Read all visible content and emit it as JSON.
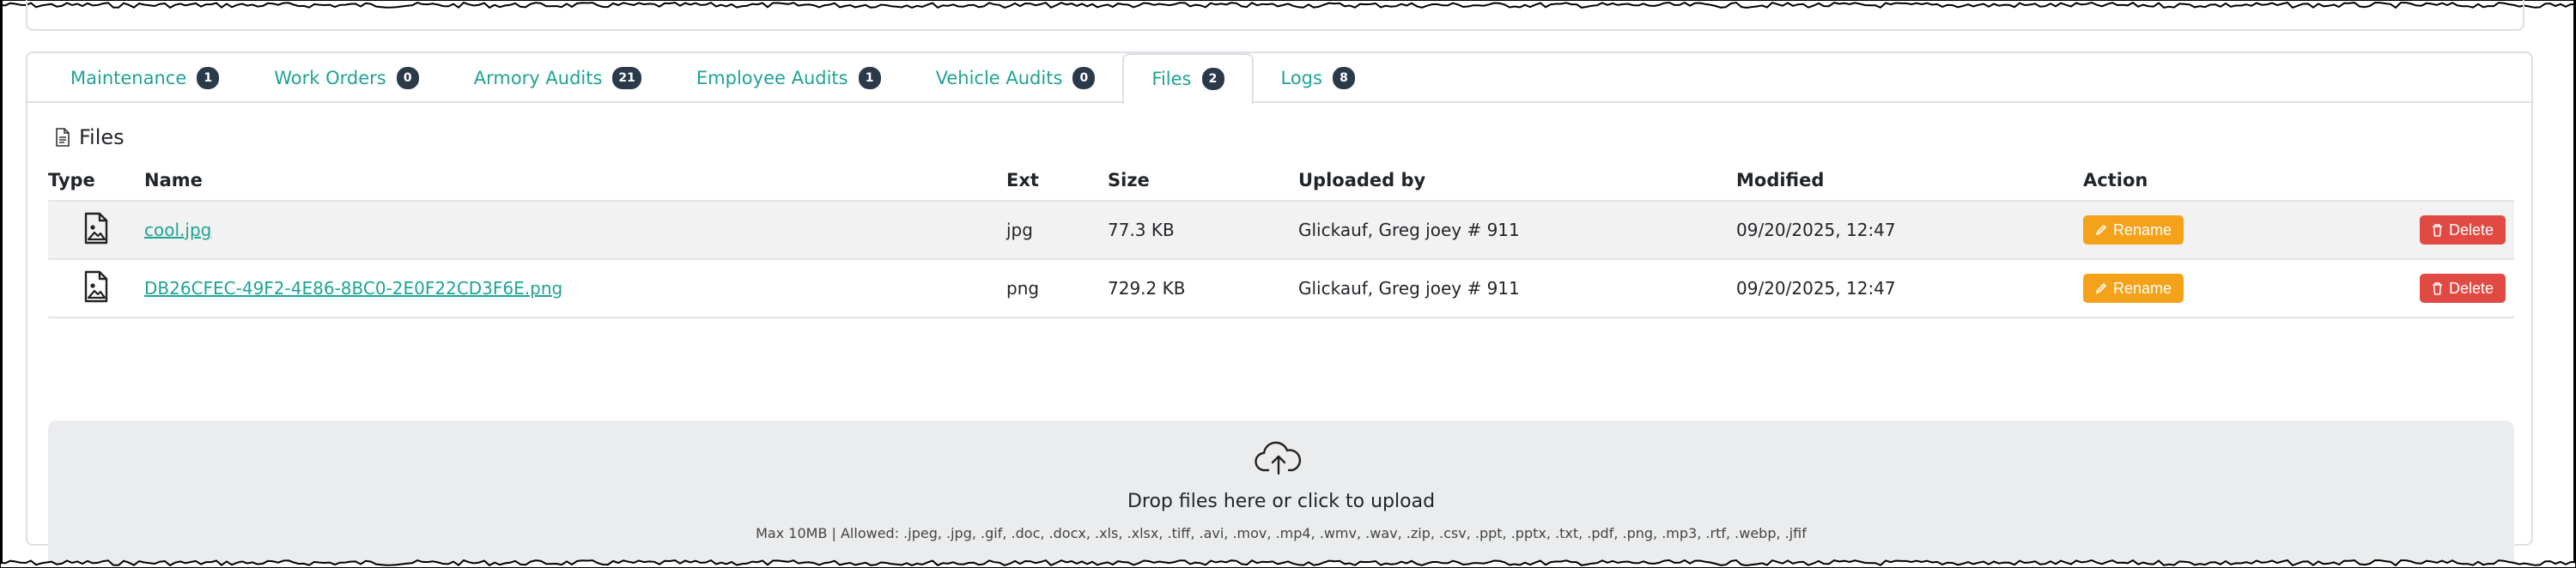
{
  "tabs": [
    {
      "label": "Maintenance",
      "count": "1"
    },
    {
      "label": "Work Orders",
      "count": "0"
    },
    {
      "label": "Armory Audits",
      "count": "21"
    },
    {
      "label": "Employee Audits",
      "count": "1"
    },
    {
      "label": "Vehicle Audits",
      "count": "0"
    },
    {
      "label": "Files",
      "count": "2"
    },
    {
      "label": "Logs",
      "count": "8"
    }
  ],
  "active_tab": "Files",
  "section": {
    "title": "Files",
    "icon": "file-icon"
  },
  "table": {
    "headers": {
      "type": "Type",
      "name": "Name",
      "ext": "Ext",
      "size": "Size",
      "uploaded_by": "Uploaded by",
      "modified": "Modified",
      "action": "Action"
    },
    "rows": [
      {
        "type_icon": "image-file-icon",
        "name": "cool.jpg",
        "ext": "jpg",
        "size": "77.3 KB",
        "uploaded_by": "Glickauf, Greg joey # 911",
        "modified": "09/20/2025, 12:47",
        "rename_label": "Rename",
        "delete_label": "Delete"
      },
      {
        "type_icon": "image-file-icon",
        "name": "DB26CFEC-49F2-4E86-8BC0-2E0F22CD3F6E.png",
        "ext": "png",
        "size": "729.2 KB",
        "uploaded_by": "Glickauf, Greg joey # 911",
        "modified": "09/20/2025, 12:47",
        "rename_label": "Rename",
        "delete_label": "Delete"
      }
    ]
  },
  "dropzone": {
    "icon": "cloud-upload-icon",
    "text": "Drop files here or click to upload",
    "hint": "Max 10MB | Allowed: .jpeg, .jpg, .gif, .doc, .docx, .xls, .xlsx, .tiff, .avi, .mov, .mp4, .wmv, .wav, .zip, .csv, .ppt, .pptx, .txt, .pdf, .png, .mp3, .rtf, .webp, .jfif"
  },
  "colors": {
    "accent": "#1fa394",
    "badge": "#2b3a4a",
    "rename": "#f4a21a",
    "delete": "#e14a43"
  }
}
